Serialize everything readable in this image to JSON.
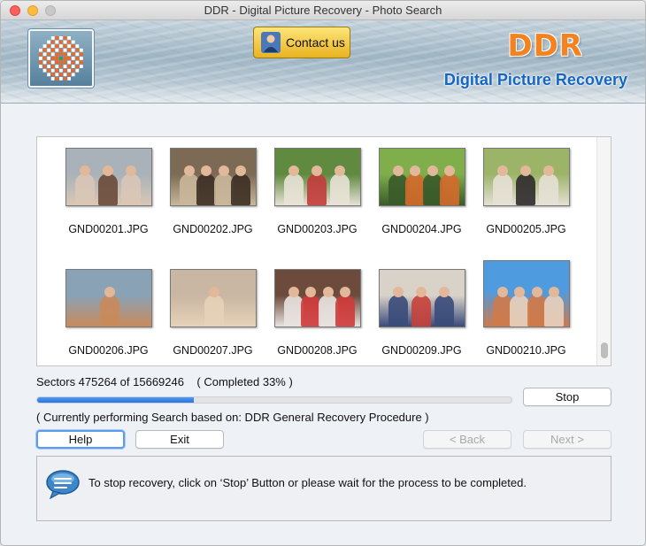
{
  "window": {
    "title": "DDR - Digital Picture Recovery - Photo Search"
  },
  "banner": {
    "contact_label": "Contact us",
    "brand": "DDR",
    "subtitle": "Digital Picture Recovery",
    "colors": {
      "brand_orange": "#f58220",
      "subtitle_blue": "#1566c4"
    }
  },
  "gallery": {
    "items": [
      {
        "name": "GND00201.JPG",
        "palette": [
          "#a9b2b8",
          "#6b4a3a",
          "#d9c7b6"
        ]
      },
      {
        "name": "GND00202.JPG",
        "palette": [
          "#7c6a55",
          "#3d2f25",
          "#c9b79b"
        ]
      },
      {
        "name": "GND00203.JPG",
        "palette": [
          "#5f8a3f",
          "#c33b3b",
          "#e8e2d6"
        ]
      },
      {
        "name": "GND00204.JPG",
        "palette": [
          "#7fae4b",
          "#d46a2b",
          "#3a5a2a"
        ]
      },
      {
        "name": "GND00205.JPG",
        "palette": [
          "#9cb468",
          "#2e2a2a",
          "#e6e0d5"
        ]
      },
      {
        "name": "GND00206.JPG",
        "palette": [
          "#8aa2b6",
          "#5a3a2a",
          "#c98a5a"
        ]
      },
      {
        "name": "GND00207.JPG",
        "palette": [
          "#c9b6a3",
          "#4e7fbf",
          "#e6d2b8"
        ]
      },
      {
        "name": "GND00208.JPG",
        "palette": [
          "#6d4b3c",
          "#cf3a3a",
          "#e9e3e0"
        ]
      },
      {
        "name": "GND00209.JPG",
        "palette": [
          "#d9d2c8",
          "#c8433a",
          "#3a4b7a"
        ]
      },
      {
        "name": "GND00210.JPG",
        "palette": [
          "#4f9be0",
          "#e9d2bf",
          "#cf7a4a"
        ]
      }
    ]
  },
  "progress": {
    "sectors_text": "Sectors 475264 of 15669246",
    "completed_text": "( Completed 33% )",
    "fraction": 0.33,
    "stop_label": "Stop",
    "status_text": "( Currently performing Search based on: DDR General Recovery Procedure )"
  },
  "nav": {
    "help_label": "Help",
    "exit_label": "Exit",
    "back_label": "< Back",
    "next_label": "Next >"
  },
  "info": {
    "message": "To stop recovery, click on ‘Stop’ Button or please wait for the process to be completed."
  }
}
